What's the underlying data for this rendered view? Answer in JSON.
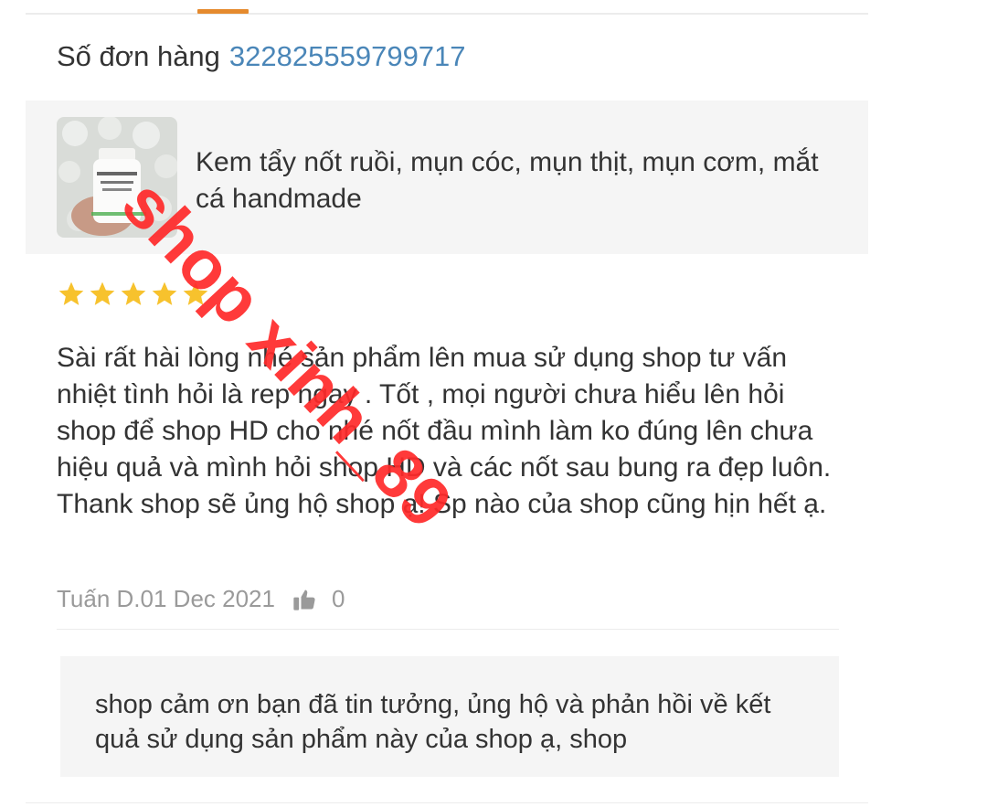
{
  "order": {
    "label": "Số đơn hàng",
    "number": "322825559799717"
  },
  "product": {
    "name": "Kem tẩy nốt ruồi, mụn cóc, mụn thịt, mụn cơm, mắt cá handmade",
    "thumbnail_icon": "product-bottle-image"
  },
  "review": {
    "rating": 5,
    "rating_max": 5,
    "text": "Sài rất hài lòng nhé sản phẩm lên mua sử dụng shop tư vấn nhiệt tình hỏi là rep ngay . Tốt , mọi người chưa hiểu lên hỏi shop để shop HD cho nhé nốt đầu mình làm ko đúng lên chưa hiệu quả và mình hỏi shop HD và các nốt sau bung ra đẹp luôn. Thank shop sẽ ủng hộ shop ạ! Sp nào của shop cũng hịn hết ạ.",
    "author": "Tuấn D.",
    "date": "01 Dec 2021",
    "likes": "0"
  },
  "reply": {
    "text": "shop cảm ơn bạn đã tin tưởng, ủng hộ và phản hồi về kết quả sử dụng sản phẩm này của shop ạ, shop"
  },
  "watermark": "shop xinh_89",
  "colors": {
    "accent": "#e58a2e",
    "link": "#4a86b8",
    "star": "#f7c22d",
    "watermark": "#ff2a2a",
    "muted": "#9a9a9a"
  }
}
